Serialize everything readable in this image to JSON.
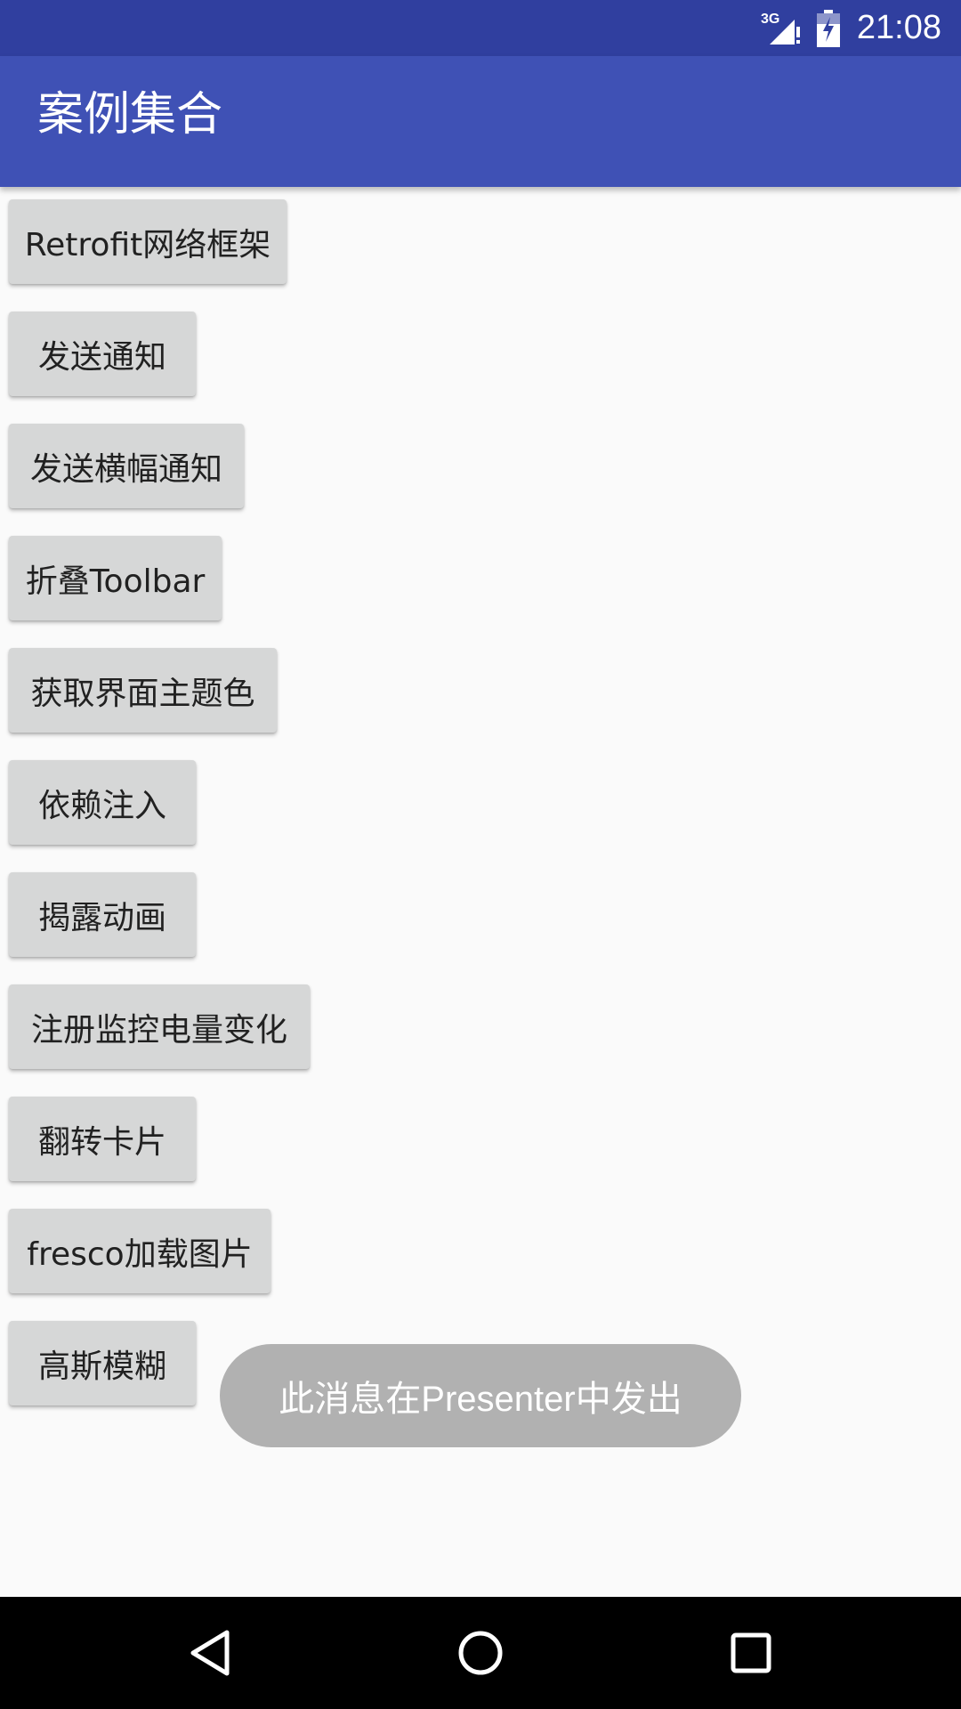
{
  "status_bar": {
    "network_label": "3G",
    "time": "21:08"
  },
  "app_bar": {
    "title": "案例集合"
  },
  "buttons": [
    {
      "label": "Retrofit网络框架"
    },
    {
      "label": "发送通知"
    },
    {
      "label": "发送横幅通知"
    },
    {
      "label": "折叠Toolbar"
    },
    {
      "label": "获取界面主题色"
    },
    {
      "label": "依赖注入"
    },
    {
      "label": "揭露动画"
    },
    {
      "label": "注册监控电量变化"
    },
    {
      "label": "翻转卡片"
    },
    {
      "label": "fresco加载图片"
    },
    {
      "label": "高斯模糊"
    }
  ],
  "toast": {
    "message": "此消息在Presenter中发出"
  },
  "nav_bar": {
    "icons": [
      "back-icon",
      "home-icon",
      "recents-icon"
    ]
  },
  "colors": {
    "status_bar": "#303f9f",
    "app_bar": "#3f51b5",
    "background": "#fafafa",
    "button": "#d6d7d7",
    "toast": "#b1b1b1",
    "nav_bar": "#000000"
  }
}
